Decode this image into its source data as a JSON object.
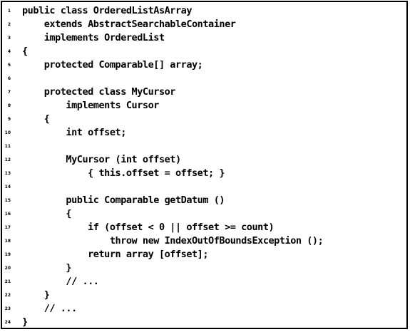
{
  "listing": {
    "indent_unit": "    ",
    "lines": [
      {
        "number": "1",
        "indent": 0,
        "code": "public class OrderedListAsArray"
      },
      {
        "number": "2",
        "indent": 1,
        "code": "extends AbstractSearchableContainer"
      },
      {
        "number": "3",
        "indent": 1,
        "code": "implements OrderedList"
      },
      {
        "number": "4",
        "indent": 0,
        "code": "{"
      },
      {
        "number": "5",
        "indent": 1,
        "code": "protected Comparable[] array;"
      },
      {
        "number": "6",
        "indent": 0,
        "code": ""
      },
      {
        "number": "7",
        "indent": 1,
        "code": "protected class MyCursor"
      },
      {
        "number": "8",
        "indent": 2,
        "code": "implements Cursor"
      },
      {
        "number": "9",
        "indent": 1,
        "code": "{"
      },
      {
        "number": "10",
        "indent": 2,
        "code": "int offset;"
      },
      {
        "number": "11",
        "indent": 0,
        "code": ""
      },
      {
        "number": "12",
        "indent": 2,
        "code": "MyCursor (int offset)"
      },
      {
        "number": "13",
        "indent": 3,
        "code": "{ this.offset = offset; }"
      },
      {
        "number": "14",
        "indent": 0,
        "code": ""
      },
      {
        "number": "15",
        "indent": 2,
        "code": "public Comparable getDatum ()"
      },
      {
        "number": "16",
        "indent": 2,
        "code": "{"
      },
      {
        "number": "17",
        "indent": 3,
        "code": "if (offset < 0 || offset >= count)"
      },
      {
        "number": "18",
        "indent": 4,
        "code": "throw new IndexOutOfBoundsException ();"
      },
      {
        "number": "19",
        "indent": 3,
        "code": "return array [offset];"
      },
      {
        "number": "20",
        "indent": 2,
        "code": "}"
      },
      {
        "number": "21",
        "indent": 2,
        "code": "// ..."
      },
      {
        "number": "22",
        "indent": 1,
        "code": "}"
      },
      {
        "number": "23",
        "indent": 1,
        "code": "// ..."
      },
      {
        "number": "24",
        "indent": 0,
        "code": "}"
      }
    ]
  }
}
